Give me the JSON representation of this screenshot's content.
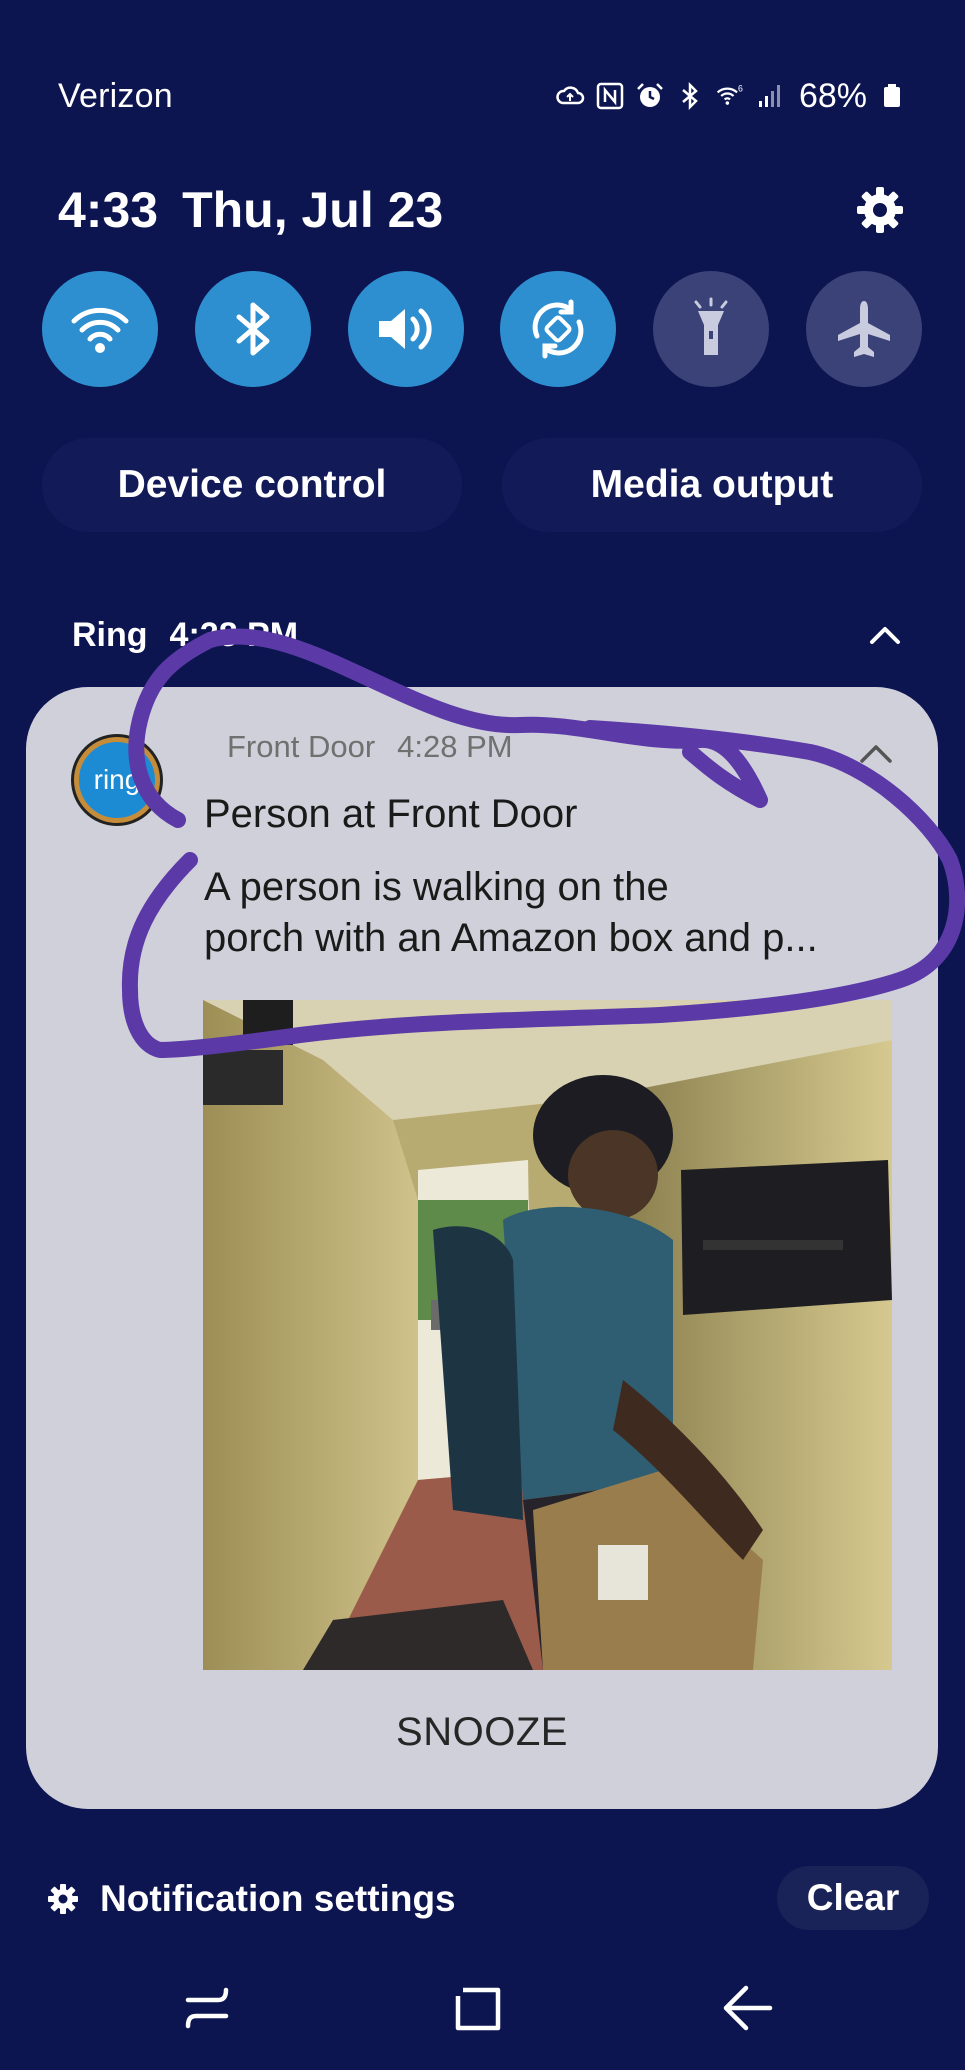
{
  "status_bar": {
    "carrier": "Verizon",
    "battery": "68%",
    "icons": [
      "cloud-sync-icon",
      "nfc-icon",
      "alarm-icon",
      "bluetooth-icon",
      "wifi-6-icon",
      "signal-icon",
      "battery-icon"
    ]
  },
  "header": {
    "time": "4:33",
    "date": "Thu, Jul 23",
    "settings_icon": "gear-icon"
  },
  "quick_settings": [
    {
      "name": "wifi",
      "icon": "wifi-icon",
      "on": true
    },
    {
      "name": "bluetooth",
      "icon": "bluetooth-icon",
      "on": true
    },
    {
      "name": "sound",
      "icon": "volume-icon",
      "on": true
    },
    {
      "name": "auto-rotate",
      "icon": "rotate-icon",
      "on": true
    },
    {
      "name": "flashlight",
      "icon": "flashlight-icon",
      "on": false
    },
    {
      "name": "airplane-mode",
      "icon": "airplane-icon",
      "on": false
    }
  ],
  "pills": {
    "device_control": "Device control",
    "media_output": "Media output"
  },
  "notification_group": {
    "app": "Ring",
    "time": "4:28 PM"
  },
  "notification": {
    "avatar_text": "ring",
    "source": "Front Door",
    "time": "4:28 PM",
    "title": "Person at Front Door",
    "body_line1": "A person is walking on the",
    "body_line2": "porch with an Amazon box and p...",
    "action": "SNOOZE"
  },
  "footer": {
    "notification_settings": "Notification settings",
    "clear": "Clear"
  },
  "colors": {
    "background": "#0d1550",
    "toggle_on": "#2e8fd0",
    "toggle_off": "#3a4278",
    "card": "#d0d0da",
    "annotation": "#5b3aa8"
  }
}
